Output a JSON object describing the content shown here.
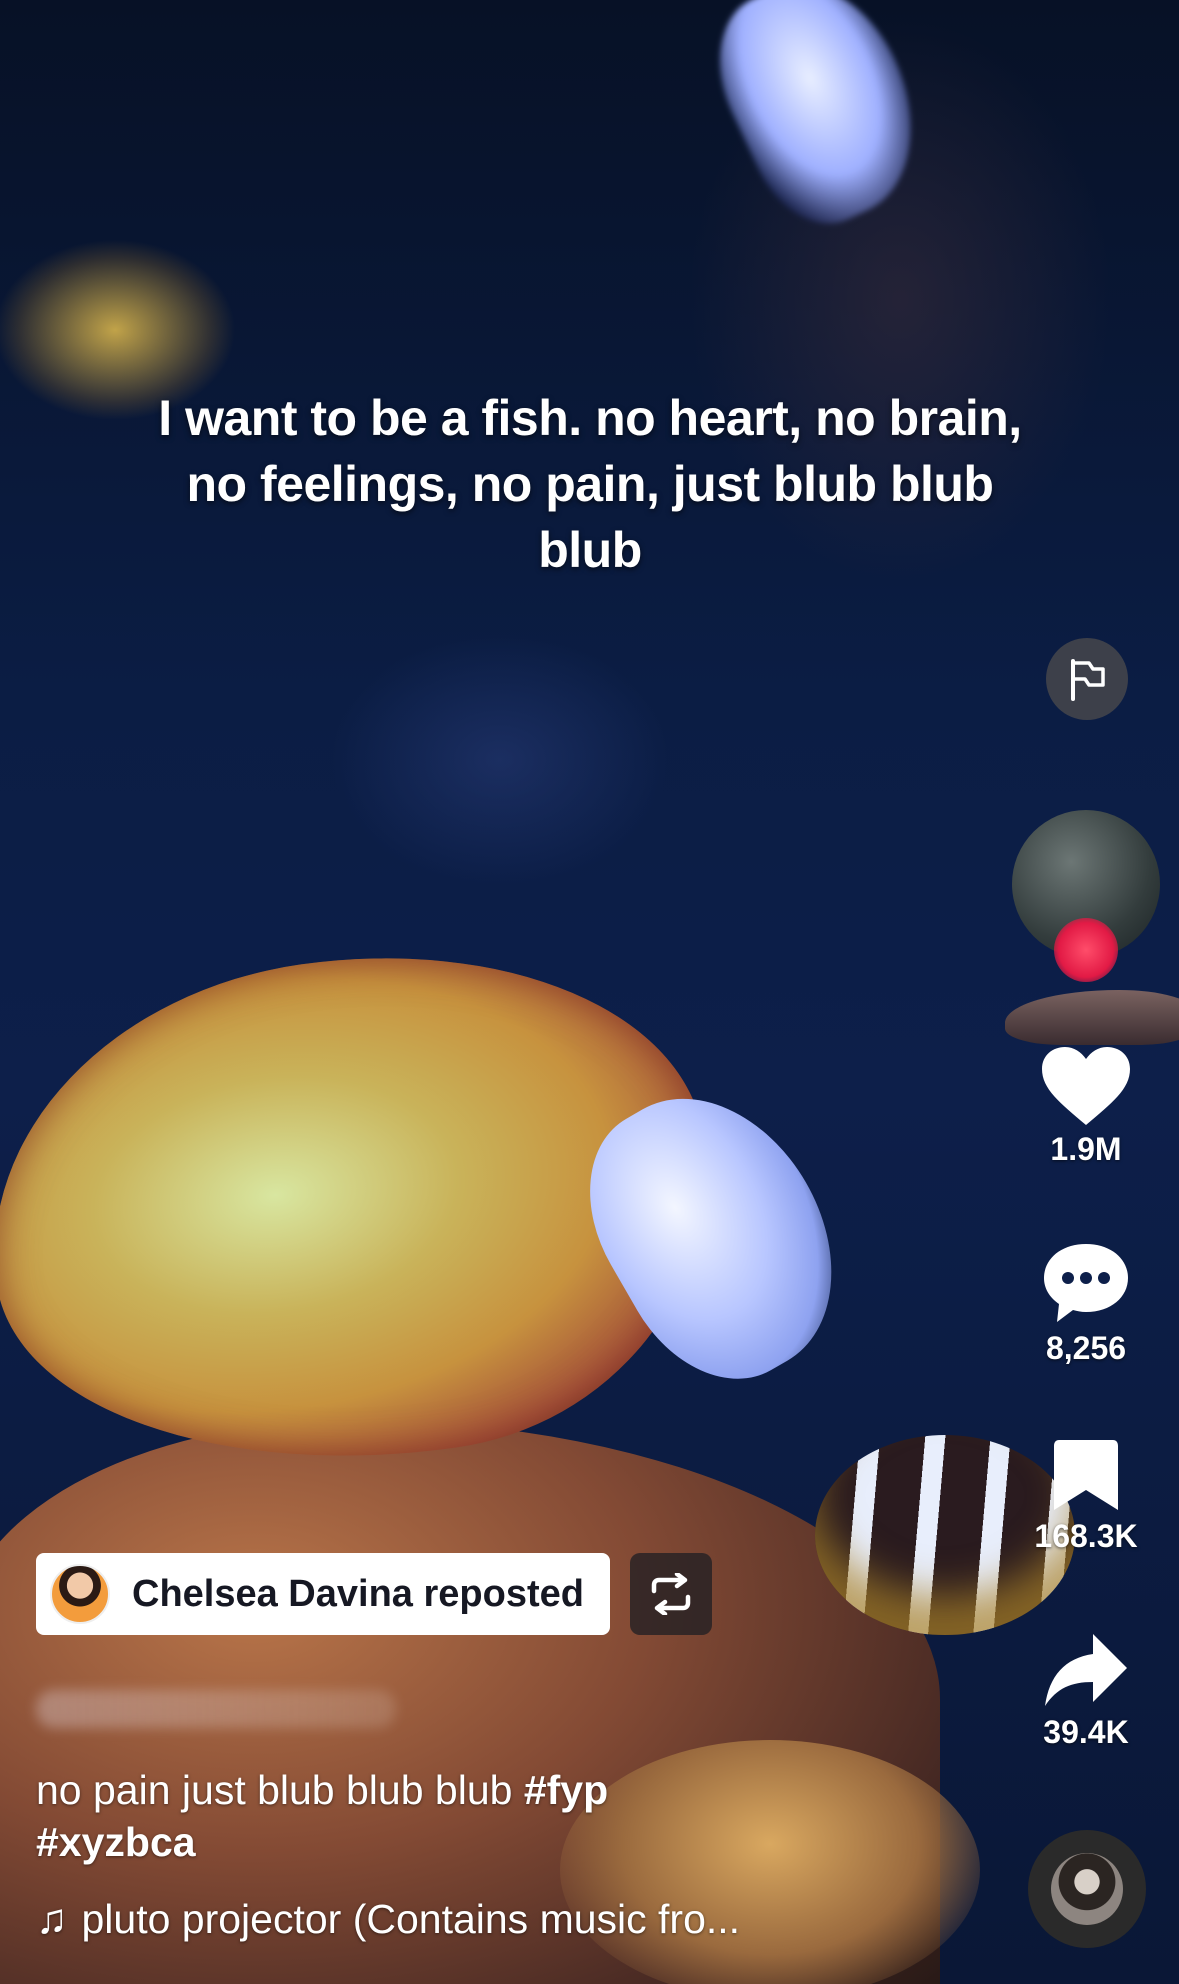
{
  "video": {
    "caption_text": "I want to be a fish. no heart, no brain, no feelings, no pain, just blub blub blub"
  },
  "actions": {
    "report_icon": "flag-icon",
    "like_count": "1.9M",
    "comment_count": "8,256",
    "bookmark_count": "168.3K",
    "share_count": "39.4K"
  },
  "repost": {
    "label": "Chelsea Davina reposted"
  },
  "description": {
    "text": "no pain just blub blub blub",
    "hashtags": [
      "#fyp",
      "#xyzbca"
    ]
  },
  "music": {
    "note_icon": "♫",
    "title": "pluto projector (Contains music fro..."
  },
  "colors": {
    "like": "#ffffff",
    "follow_dot": "#e21a45",
    "chip_background": "#ffffff"
  }
}
